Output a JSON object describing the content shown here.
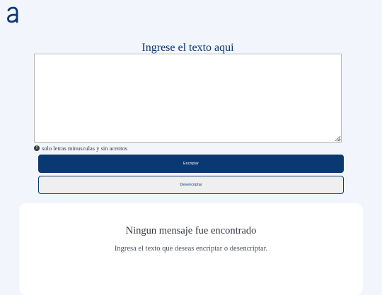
{
  "logo": {
    "icon": "alura-logo-icon",
    "color": "#0a3871"
  },
  "input_section": {
    "title": "Ingrese el texto aqui",
    "textarea_value": "",
    "hint_icon": "info-icon",
    "hint_text": "solo letras minusculas y sin acentos"
  },
  "buttons": {
    "encrypt_label": "Encriptar",
    "decrypt_label": "Desencriptar"
  },
  "output_section": {
    "title": "Ningun mensaje fue encontrado",
    "message": "Ingresa el texto que deseas encriptar o desencriptar."
  },
  "colors": {
    "background": "#f3f5fc",
    "primary": "#0a3871",
    "panel": "#ffffff",
    "text": "#343a40",
    "button_secondary": "#efefef"
  }
}
